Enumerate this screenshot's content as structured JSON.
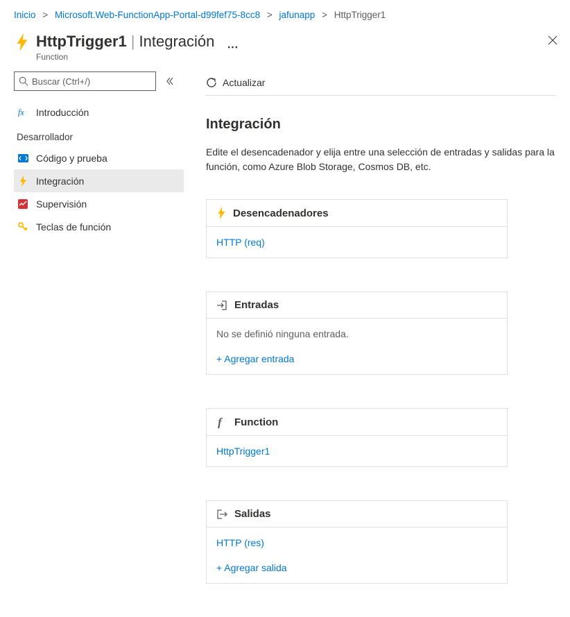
{
  "breadcrumb": {
    "home": "Inicio",
    "resource": "Microsoft.Web-FunctionApp-Portal-d99fef75-8cc8",
    "app": "jafunapp",
    "function": "HttpTrigger1"
  },
  "header": {
    "title": "HttpTrigger1",
    "subtitle": "Integración",
    "type": "Function"
  },
  "sidebar": {
    "search_placeholder": "Buscar (Ctrl+/)",
    "items": [
      {
        "label": "Introducción"
      }
    ],
    "section_title": "Desarrollador",
    "dev_items": [
      {
        "label": "Código y prueba"
      },
      {
        "label": "Integración"
      },
      {
        "label": "Supervisión"
      },
      {
        "label": "Teclas de función"
      }
    ]
  },
  "toolbar": {
    "refresh_label": "Actualizar"
  },
  "main": {
    "title": "Integración",
    "description": "Edite el desencadenador y elija entre una selección de entradas y salidas para la función, como Azure Blob Storage, Cosmos DB, etc."
  },
  "cards": {
    "triggers": {
      "title": "Desencadenadores",
      "item": "HTTP (req)"
    },
    "inputs": {
      "title": "Entradas",
      "empty_text": "No se definió ninguna entrada.",
      "add_label": "+ Agregar entrada"
    },
    "function": {
      "title": "Function",
      "item": "HttpTrigger1"
    },
    "outputs": {
      "title": "Salidas",
      "item": "HTTP (res)",
      "add_label": "+ Agregar salida"
    }
  }
}
